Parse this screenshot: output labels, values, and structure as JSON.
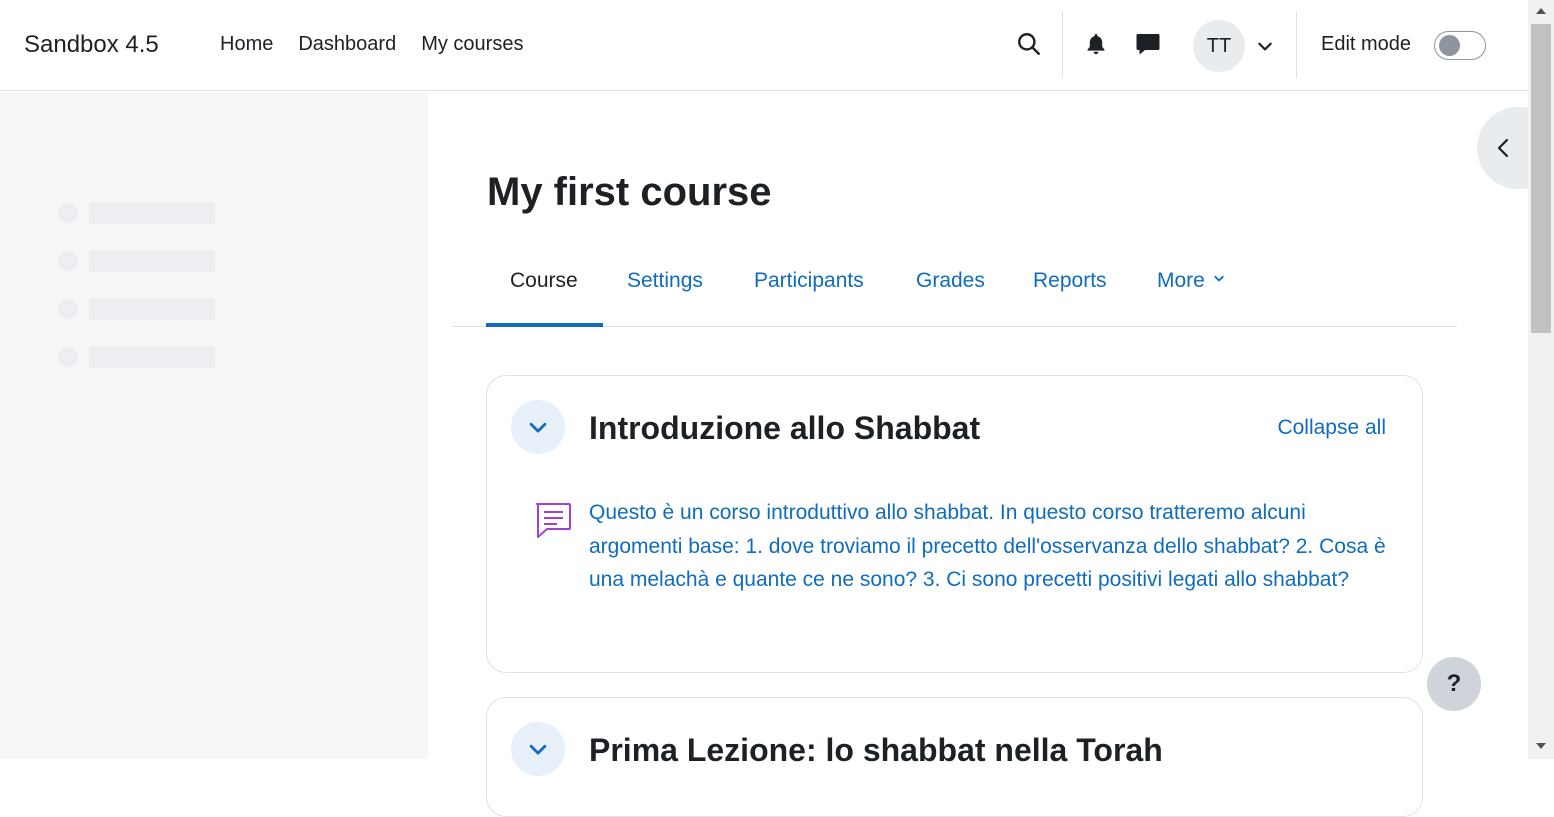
{
  "navbar": {
    "brand": "Sandbox 4.5",
    "links": [
      "Home",
      "Dashboard",
      "My courses"
    ],
    "avatar_initials": "TT",
    "edit_mode_label": "Edit mode",
    "edit_mode_on": false
  },
  "course": {
    "title": "My first course",
    "tabs": [
      {
        "label": "Course",
        "active": true
      },
      {
        "label": "Settings",
        "active": false
      },
      {
        "label": "Participants",
        "active": false
      },
      {
        "label": "Grades",
        "active": false
      },
      {
        "label": "Reports",
        "active": false
      },
      {
        "label": "More",
        "active": false
      }
    ],
    "collapse_all_label": "Collapse all",
    "sections": [
      {
        "title": "Introduzione allo Shabbat",
        "activity_text": "Questo è un corso introduttivo allo shabbat. In questo corso tratteremo alcuni argomenti base: 1. dove troviamo il precetto dell'osservanza dello shabbat? 2. Cosa è una melachà e quante ce ne sono? 3. Ci sono precetti positivi legati allo shabbat?",
        "activity_icon": "forum-icon"
      },
      {
        "title": "Prima Lezione: lo shabbat nella Torah"
      }
    ]
  },
  "help_label": "?",
  "colors": {
    "link": "#0f6cbf",
    "text": "#1d2125",
    "activity_icon": "#9b45d4",
    "drawer_bg": "#f5f6f8"
  }
}
